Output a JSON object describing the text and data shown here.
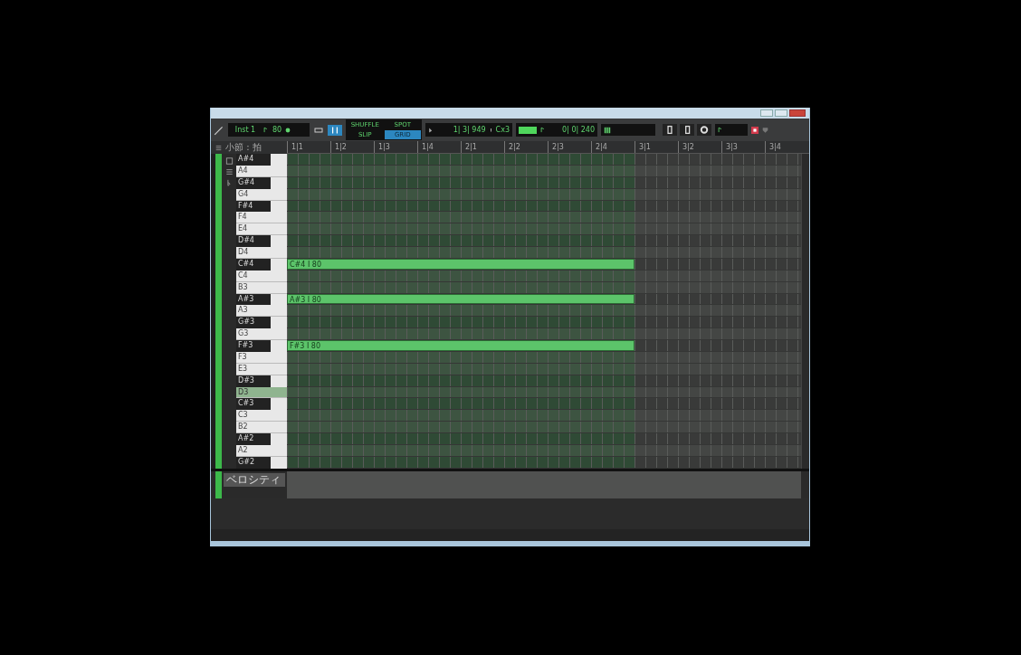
{
  "toolbar": {
    "instrument": "Inst 1",
    "velocity": "80",
    "modes": [
      {
        "label": "SHUFFLE",
        "selected": false
      },
      {
        "label": "SPOT",
        "selected": false
      },
      {
        "label": "SLIP",
        "selected": false
      },
      {
        "label": "GRID",
        "selected": true
      }
    ],
    "position": "1| 3| 949",
    "pitch": "Cx3",
    "length": "0| 0| 240"
  },
  "ruler": {
    "label": "小節 : 拍",
    "ticks": [
      "1|1",
      "1|2",
      "1|3",
      "1|4",
      "2|1",
      "2|2",
      "2|3",
      "2|4",
      "3|1",
      "3|2",
      "3|3",
      "3|4"
    ]
  },
  "keys": [
    {
      "label": "A#4",
      "kind": "black",
      "selected": false
    },
    {
      "label": "A4",
      "kind": "white",
      "selected": false
    },
    {
      "label": "G#4",
      "kind": "black",
      "selected": false
    },
    {
      "label": "G4",
      "kind": "white",
      "selected": false
    },
    {
      "label": "F#4",
      "kind": "black",
      "selected": false
    },
    {
      "label": "F4",
      "kind": "white",
      "selected": false
    },
    {
      "label": "E4",
      "kind": "white",
      "selected": false
    },
    {
      "label": "D#4",
      "kind": "black",
      "selected": false
    },
    {
      "label": "D4",
      "kind": "white",
      "selected": false
    },
    {
      "label": "C#4",
      "kind": "black",
      "selected": false,
      "notes": [
        "C#4 I 80"
      ]
    },
    {
      "label": "C4",
      "kind": "white",
      "selected": false
    },
    {
      "label": "B3",
      "kind": "white",
      "selected": false
    },
    {
      "label": "A#3",
      "kind": "black",
      "selected": false,
      "notes": [
        "A#3 I 80"
      ]
    },
    {
      "label": "A3",
      "kind": "white",
      "selected": false
    },
    {
      "label": "G#3",
      "kind": "black",
      "selected": false
    },
    {
      "label": "G3",
      "kind": "white",
      "selected": false
    },
    {
      "label": "F#3",
      "kind": "black",
      "selected": false,
      "notes": [
        "F#3 I 80"
      ]
    },
    {
      "label": "F3",
      "kind": "white",
      "selected": false
    },
    {
      "label": "E3",
      "kind": "white",
      "selected": false
    },
    {
      "label": "D#3",
      "kind": "black",
      "selected": false
    },
    {
      "label": "D3",
      "kind": "white",
      "selected": true
    },
    {
      "label": "C#3",
      "kind": "black",
      "selected": false
    },
    {
      "label": "C3",
      "kind": "white",
      "selected": false
    },
    {
      "label": "B2",
      "kind": "white",
      "selected": false
    },
    {
      "label": "A#2",
      "kind": "black",
      "selected": false
    },
    {
      "label": "A2",
      "kind": "white",
      "selected": false
    },
    {
      "label": "G#2",
      "kind": "black",
      "selected": false
    }
  ],
  "velocity_lane": {
    "parameter": "ベロシティ"
  }
}
